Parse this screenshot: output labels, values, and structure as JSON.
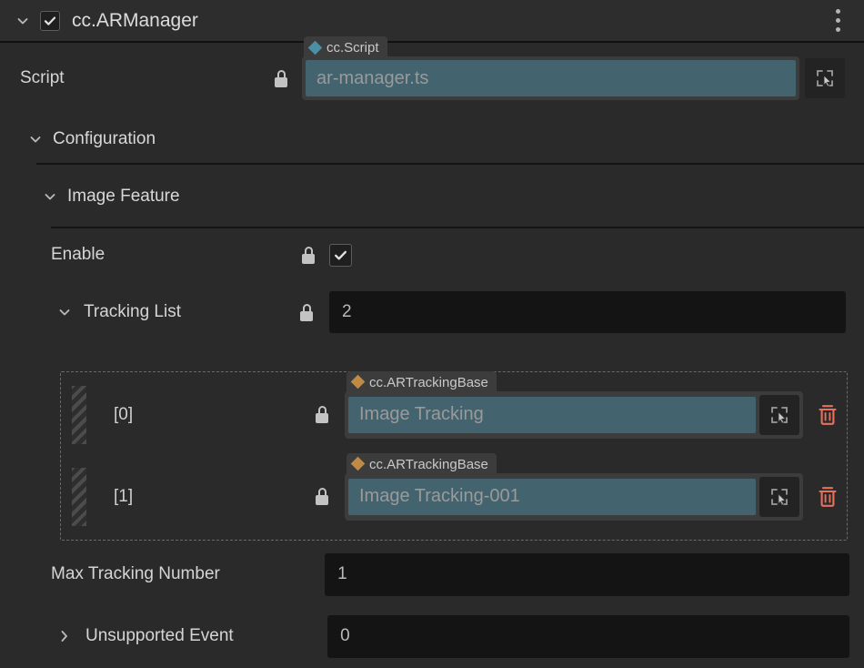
{
  "component": {
    "title": "cc.ARManager",
    "enabled": true,
    "expanded": true,
    "collapse_icon": "chevron-down-icon",
    "menu_icon": "kebab-menu-icon"
  },
  "script_row": {
    "label": "Script",
    "locked": true,
    "lock_icon": "lock-icon",
    "type_badge": "cc.Script",
    "badge_color": "#4a90a4",
    "value": "ar-manager.ts",
    "pick_icon": "select-node-icon"
  },
  "sections": [
    {
      "label": "Configuration",
      "expanded": true,
      "icon": "chevron-down-icon"
    },
    {
      "label": "Image Feature",
      "expanded": true,
      "icon": "chevron-down-icon"
    }
  ],
  "enable_row": {
    "label": "Enable",
    "locked": true,
    "lock_icon": "lock-icon",
    "checked": true
  },
  "tracking_list": {
    "label": "Tracking List",
    "expanded": true,
    "icon": "chevron-down-icon",
    "locked": true,
    "lock_icon": "lock-icon",
    "count": "2",
    "items": [
      {
        "index": "[0]",
        "locked": true,
        "lock_icon": "lock-icon",
        "type_badge": "cc.ARTrackingBase",
        "badge_color": "#c08a42",
        "value": "Image Tracking",
        "pick_icon": "select-node-icon",
        "delete_icon": "trash-icon",
        "drag_icon": "drag-grip-icon"
      },
      {
        "index": "[1]",
        "locked": true,
        "lock_icon": "lock-icon",
        "type_badge": "cc.ARTrackingBase",
        "badge_color": "#c08a42",
        "value": "Image Tracking-001",
        "pick_icon": "select-node-icon",
        "delete_icon": "trash-icon",
        "drag_icon": "drag-grip-icon"
      }
    ]
  },
  "max_tracking_number": {
    "label": "Max Tracking Number",
    "value": "1"
  },
  "unsupported_event": {
    "label": "Unsupported Event",
    "expanded": false,
    "icon": "chevron-right-icon",
    "value": "0"
  },
  "colors": {
    "panel_bg": "#2a2a2a",
    "header_bg": "#2d2d2d",
    "ref_field": "#43636f",
    "dark_field": "#141414",
    "badge_bg": "#3c3c3c",
    "trash_red": "#e8705c",
    "divider": "#141414"
  }
}
